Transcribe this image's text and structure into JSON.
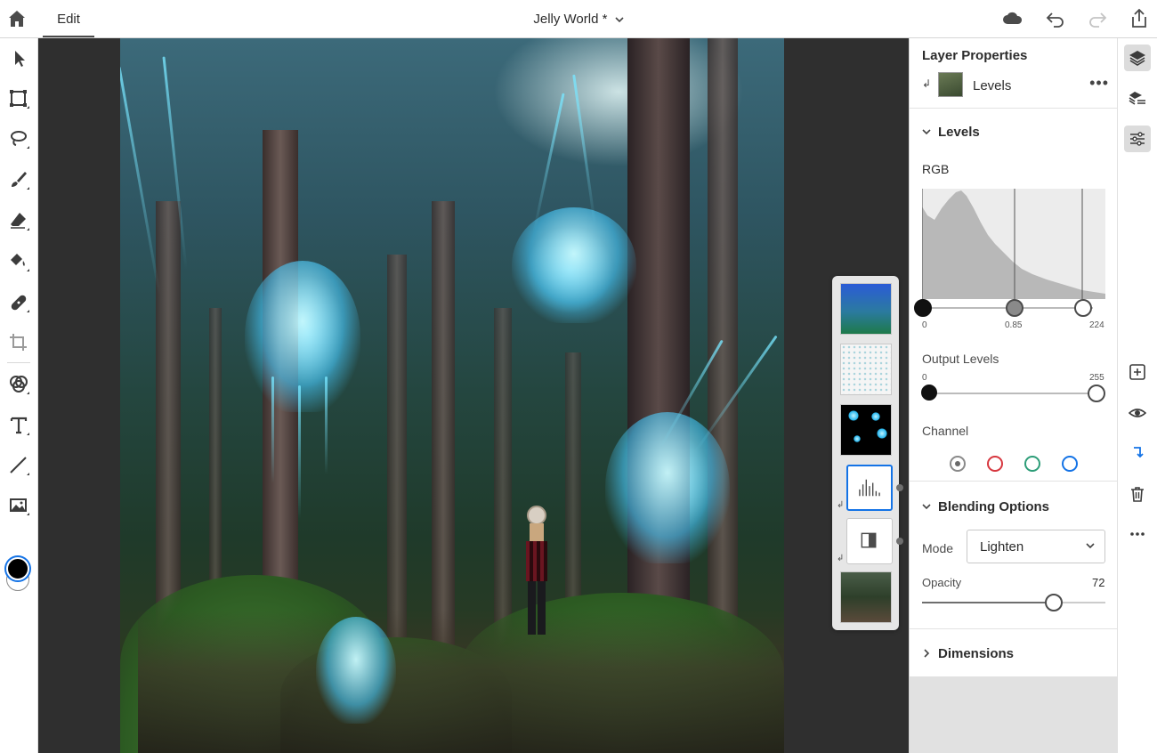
{
  "topbar": {
    "tab_edit": "Edit",
    "doc_title": "Jelly World *"
  },
  "layer_properties": {
    "title": "Layer Properties",
    "layer_name": "Levels",
    "more": "•••"
  },
  "levels": {
    "section_title": "Levels",
    "channel_label": "RGB",
    "input_black": "0",
    "input_gamma": "0.85",
    "input_white": "224",
    "output_title": "Output Levels",
    "output_black": "0",
    "output_white": "255",
    "channel_title": "Channel",
    "channels": [
      "gray",
      "red",
      "green",
      "blue"
    ]
  },
  "blending": {
    "section_title": "Blending Options",
    "mode_label": "Mode",
    "mode_value": "Lighten",
    "opacity_label": "Opacity",
    "opacity_value": "72",
    "opacity_fraction": 0.72
  },
  "dimensions": {
    "section_title": "Dimensions"
  },
  "colors": {
    "accent": "#1473e6",
    "foreground_swatch": "#000000",
    "background_swatch": "#ffffff"
  }
}
